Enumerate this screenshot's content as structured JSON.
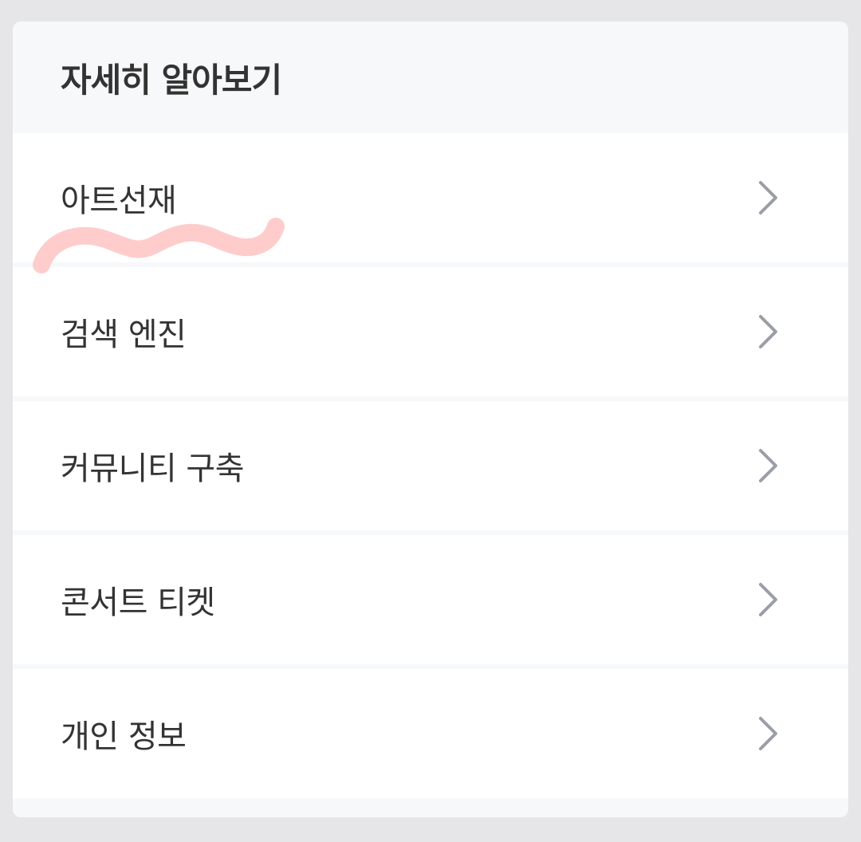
{
  "header": {
    "title": "자세히 알아보기"
  },
  "menu": {
    "items": [
      {
        "label": "아트선재",
        "icon": "chevron-right-icon"
      },
      {
        "label": "검색 엔진",
        "icon": "chevron-right-icon"
      },
      {
        "label": "커뮤니티 구축",
        "icon": "chevron-right-icon"
      },
      {
        "label": "콘서트 티켓",
        "icon": "chevron-right-icon"
      },
      {
        "label": "개인 정보",
        "icon": "chevron-right-icon"
      }
    ]
  },
  "colors": {
    "page_background": "#e6e6e8",
    "header_background": "#f7f8fa",
    "item_background": "#ffffff",
    "text": "#333333",
    "chevron": "#9a9ea5",
    "annotation_scribble": "#ffc9c9"
  }
}
